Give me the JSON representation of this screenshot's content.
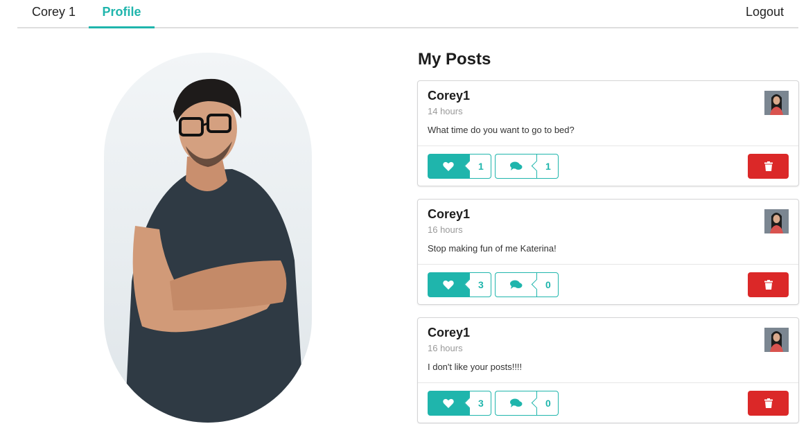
{
  "nav": {
    "user_label": "Corey 1",
    "profile_label": "Profile",
    "logout_label": "Logout"
  },
  "posts_title": "My Posts",
  "colors": {
    "accent": "#1fb5ac",
    "danger": "#db2828"
  },
  "posts": [
    {
      "author": "Corey1",
      "time": "14 hours",
      "text": "What time do you want to go to bed?",
      "likes": "1",
      "comments": "1"
    },
    {
      "author": "Corey1",
      "time": "16 hours",
      "text": "Stop making fun of me Katerina!",
      "likes": "3",
      "comments": "0"
    },
    {
      "author": "Corey1",
      "time": "16 hours",
      "text": "I don't like your posts!!!!",
      "likes": "3",
      "comments": "0"
    }
  ],
  "icons": {
    "like": "heart-icon",
    "comment": "comments-icon",
    "delete": "trash-icon"
  }
}
